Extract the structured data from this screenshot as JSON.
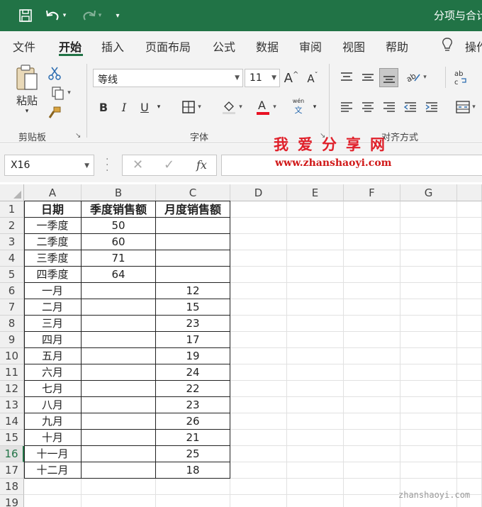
{
  "titlebar": {
    "title": "分项与合计",
    "icons": [
      "save-icon",
      "undo-icon",
      "redo-icon",
      "customize-qat-icon"
    ]
  },
  "menu": {
    "tabs": [
      {
        "label": "文件",
        "active": false
      },
      {
        "label": "开始",
        "active": true
      },
      {
        "label": "插入",
        "active": false
      },
      {
        "label": "页面布局",
        "active": false
      },
      {
        "label": "公式",
        "active": false
      },
      {
        "label": "数据",
        "active": false
      },
      {
        "label": "审阅",
        "active": false
      },
      {
        "label": "视图",
        "active": false
      },
      {
        "label": "帮助",
        "active": false
      }
    ],
    "tell_me": "操作"
  },
  "ribbon": {
    "clipboard": {
      "paste_label": "粘贴",
      "group_label": "剪贴板"
    },
    "font": {
      "font_name": "等线",
      "font_size": "11",
      "group_label": "字体",
      "bold": "B",
      "italic": "I",
      "underline": "U",
      "phonetic_top": "wén",
      "phonetic_bottom": "文",
      "font_color": "#e81123"
    },
    "alignment": {
      "group_label": "对齐方式"
    }
  },
  "watermark": {
    "chinese": "我爱分享网",
    "url": "www.zhanshaoyi.com",
    "corner": "zhanshaoyi.com"
  },
  "formula_bar": {
    "name_box": "X16",
    "fx": "fx",
    "content": ""
  },
  "sheet": {
    "columns": [
      "A",
      "B",
      "C",
      "D",
      "E",
      "F",
      "G"
    ],
    "selected_row": "16",
    "header": [
      "日期",
      "季度销售额",
      "月度销售额"
    ],
    "rows": [
      {
        "num": "1"
      },
      {
        "num": "2",
        "a": "一季度",
        "b": "50",
        "c": ""
      },
      {
        "num": "3",
        "a": "二季度",
        "b": "60",
        "c": ""
      },
      {
        "num": "4",
        "a": "三季度",
        "b": "71",
        "c": ""
      },
      {
        "num": "5",
        "a": "四季度",
        "b": "64",
        "c": ""
      },
      {
        "num": "6",
        "a": "一月",
        "b": "",
        "c": "12"
      },
      {
        "num": "7",
        "a": "二月",
        "b": "",
        "c": "15"
      },
      {
        "num": "8",
        "a": "三月",
        "b": "",
        "c": "23"
      },
      {
        "num": "9",
        "a": "四月",
        "b": "",
        "c": "17"
      },
      {
        "num": "10",
        "a": "五月",
        "b": "",
        "c": "19"
      },
      {
        "num": "11",
        "a": "六月",
        "b": "",
        "c": "24"
      },
      {
        "num": "12",
        "a": "七月",
        "b": "",
        "c": "22"
      },
      {
        "num": "13",
        "a": "八月",
        "b": "",
        "c": "23"
      },
      {
        "num": "14",
        "a": "九月",
        "b": "",
        "c": "26"
      },
      {
        "num": "15",
        "a": "十月",
        "b": "",
        "c": "21"
      },
      {
        "num": "16",
        "a": "十一月",
        "b": "",
        "c": "25"
      },
      {
        "num": "17",
        "a": "十二月",
        "b": "",
        "c": "18"
      },
      {
        "num": "18"
      },
      {
        "num": "19"
      }
    ]
  },
  "accent_color": "#217346"
}
